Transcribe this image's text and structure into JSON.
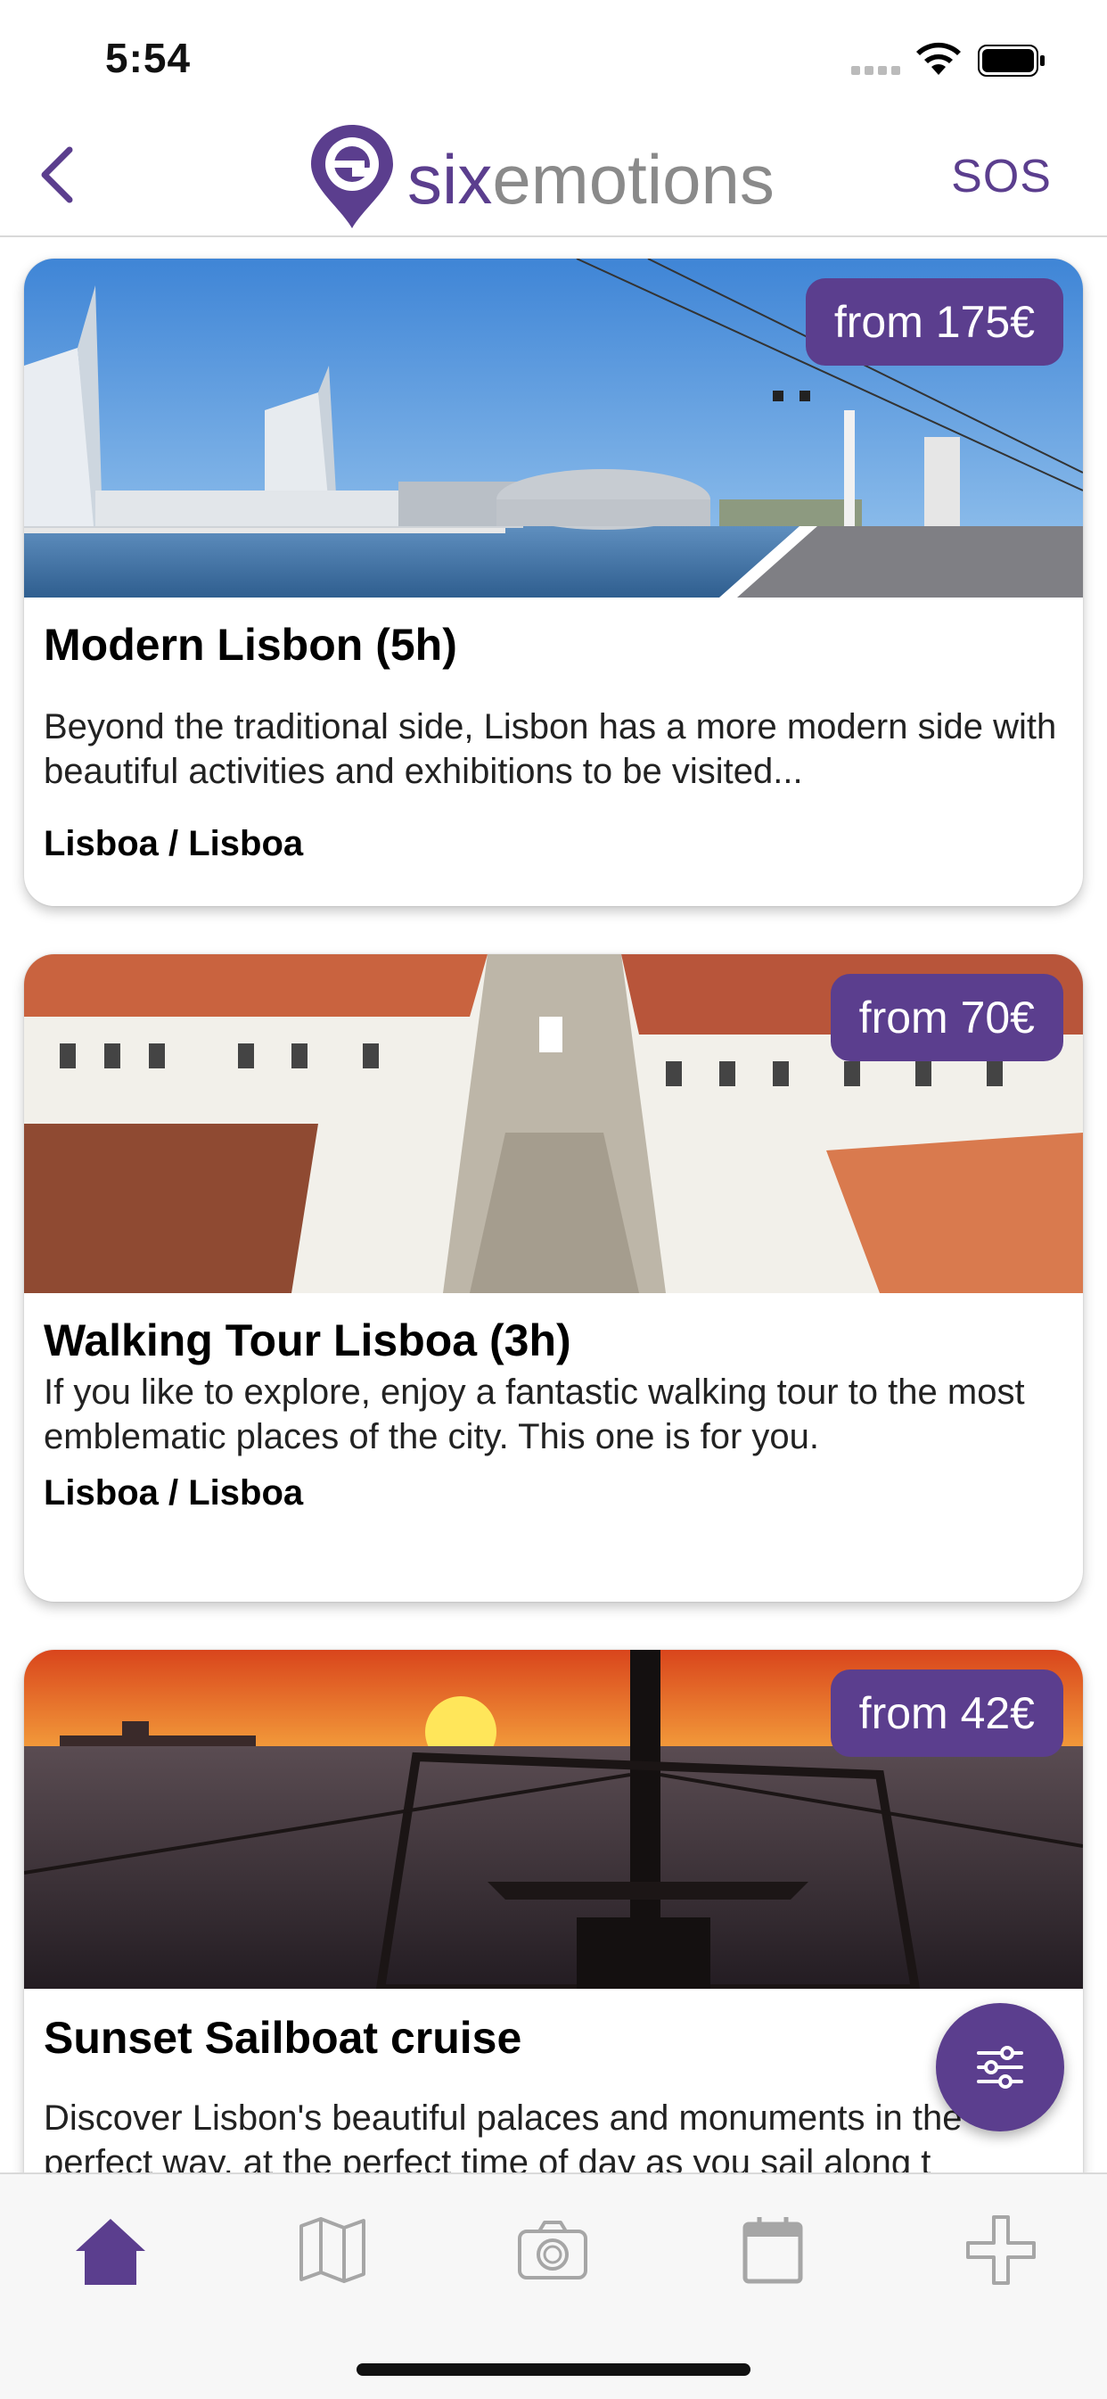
{
  "status_bar": {
    "time": "5:54"
  },
  "nav": {
    "back_icon": "chevron-left-icon",
    "logo_text_six": "six",
    "logo_text_emotions": "emotions",
    "sos_label": "SOS"
  },
  "cards": [
    {
      "price": "from 175€",
      "title": "Modern Lisbon (5h)",
      "description": "Beyond the traditional side, Lisbon has a more modern side with beautiful activities and exhibitions to be visited...",
      "location": "Lisboa / Lisboa"
    },
    {
      "price": "from 70€",
      "title": "Walking Tour Lisboa (3h)",
      "description": "If you like to explore, enjoy a fantastic walking tour to the most emblematic places of the city. This one is for you.",
      "location": "Lisboa / Lisboa"
    },
    {
      "price": "from 42€",
      "title": "Sunset Sailboat cruise",
      "description": "Discover Lisbon's beautiful palaces and monuments in the perfect way, at the perfect time of day as you sail along t"
    }
  ],
  "tabs": [
    {
      "icon": "home-icon",
      "active": true
    },
    {
      "icon": "map-icon",
      "active": false
    },
    {
      "icon": "camera-icon",
      "active": false
    },
    {
      "icon": "calendar-icon",
      "active": false
    },
    {
      "icon": "plus-icon",
      "active": false
    }
  ],
  "colors": {
    "accent": "#5b3e8e",
    "inactive_icon": "#a6a6a6"
  }
}
